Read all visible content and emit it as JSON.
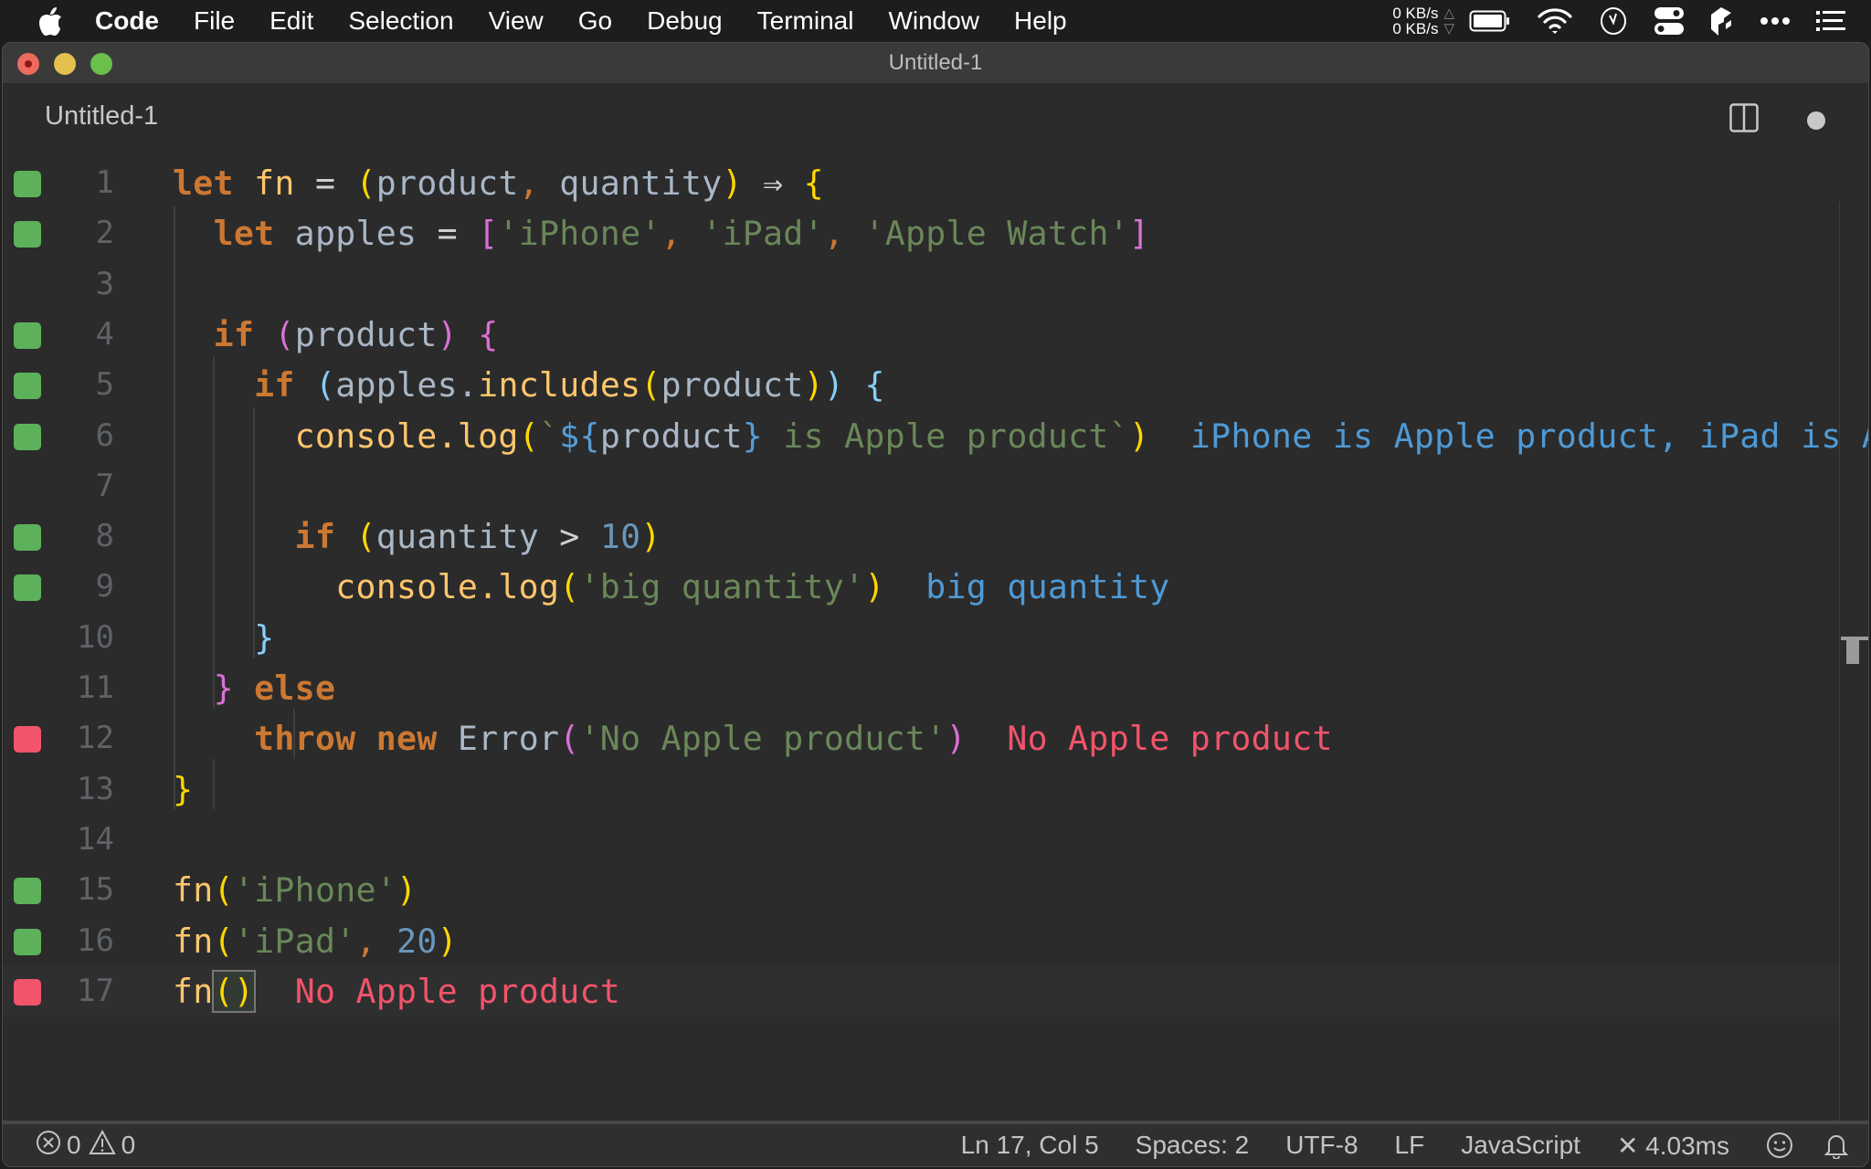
{
  "menubar": {
    "app_name": "Code",
    "items": [
      "File",
      "Edit",
      "Selection",
      "View",
      "Go",
      "Debug",
      "Terminal",
      "Window",
      "Help"
    ],
    "net_up": "0 KB/s",
    "net_down": "0 KB/s",
    "status_icons": [
      "battery-icon",
      "wifi-icon",
      "clock-icon",
      "control-center-icon",
      "app-extension-icon",
      "more-icon",
      "list-icon"
    ]
  },
  "window": {
    "title": "Untitled-1"
  },
  "tab": {
    "title": "Untitled-1",
    "dirty": true
  },
  "editor": {
    "current_line": 17,
    "lines": [
      {
        "n": "1",
        "marker": "ok",
        "tokens": [
          [
            "kw",
            "let"
          ],
          [
            "op",
            " "
          ],
          [
            "fn",
            "fn"
          ],
          [
            "op",
            " = "
          ],
          [
            "b-yellow",
            "("
          ],
          [
            "var",
            "product"
          ],
          [
            "punc",
            ", "
          ],
          [
            "var",
            "quantity"
          ],
          [
            "b-yellow",
            ")"
          ],
          [
            "op",
            " ⇒ "
          ],
          [
            "b-yellow",
            "{"
          ]
        ]
      },
      {
        "n": "2",
        "marker": "ok",
        "tokens": [
          [
            "op",
            "  "
          ],
          [
            "kw",
            "let"
          ],
          [
            "var",
            " apples "
          ],
          [
            "op",
            "= "
          ],
          [
            "b-pink",
            "["
          ],
          [
            "str",
            "'iPhone'"
          ],
          [
            "punc",
            ", "
          ],
          [
            "str",
            "'iPad'"
          ],
          [
            "punc",
            ", "
          ],
          [
            "str",
            "'Apple Watch'"
          ],
          [
            "b-pink",
            "]"
          ]
        ]
      },
      {
        "n": "3",
        "marker": "",
        "tokens": []
      },
      {
        "n": "4",
        "marker": "ok",
        "tokens": [
          [
            "op",
            "  "
          ],
          [
            "kw",
            "if"
          ],
          [
            "op",
            " "
          ],
          [
            "b-pink",
            "("
          ],
          [
            "var",
            "product"
          ],
          [
            "b-pink",
            ")"
          ],
          [
            "op",
            " "
          ],
          [
            "b-pink",
            "{"
          ]
        ]
      },
      {
        "n": "5",
        "marker": "ok",
        "tokens": [
          [
            "op",
            "    "
          ],
          [
            "kw",
            "if"
          ],
          [
            "op",
            " "
          ],
          [
            "b-blue",
            "("
          ],
          [
            "var",
            "apples."
          ],
          [
            "fn",
            "includes"
          ],
          [
            "b-yellow",
            "("
          ],
          [
            "var",
            "product"
          ],
          [
            "b-yellow",
            ")"
          ],
          [
            "b-blue",
            ")"
          ],
          [
            "op",
            " "
          ],
          [
            "b-blue",
            "{"
          ]
        ]
      },
      {
        "n": "6",
        "marker": "ok",
        "tokens": [
          [
            "op",
            "      "
          ],
          [
            "fn",
            "console.log"
          ],
          [
            "b-yellow",
            "("
          ],
          [
            "str",
            "`"
          ],
          [
            "tpl",
            "${"
          ],
          [
            "var",
            "product"
          ],
          [
            "tpl",
            "}"
          ],
          [
            "str",
            " is Apple product`"
          ],
          [
            "b-yellow",
            ")"
          ],
          [
            "op",
            "  "
          ],
          [
            "out-ok",
            "iPhone is Apple product, iPad is Apple product"
          ]
        ]
      },
      {
        "n": "7",
        "marker": "",
        "tokens": []
      },
      {
        "n": "8",
        "marker": "ok",
        "tokens": [
          [
            "op",
            "      "
          ],
          [
            "kw",
            "if"
          ],
          [
            "op",
            " "
          ],
          [
            "b-yellow",
            "("
          ],
          [
            "var",
            "quantity "
          ],
          [
            "op",
            "> "
          ],
          [
            "num",
            "10"
          ],
          [
            "b-yellow",
            ")"
          ]
        ]
      },
      {
        "n": "9",
        "marker": "ok",
        "tokens": [
          [
            "op",
            "        "
          ],
          [
            "fn",
            "console.log"
          ],
          [
            "b-yellow",
            "("
          ],
          [
            "str",
            "'big quantity'"
          ],
          [
            "b-yellow",
            ")"
          ],
          [
            "op",
            "  "
          ],
          [
            "out-ok",
            "big quantity"
          ]
        ]
      },
      {
        "n": "10",
        "marker": "",
        "tokens": [
          [
            "op",
            "    "
          ],
          [
            "b-blue",
            "}"
          ]
        ]
      },
      {
        "n": "11",
        "marker": "",
        "tokens": [
          [
            "op",
            "  "
          ],
          [
            "b-pink",
            "}"
          ],
          [
            "op",
            " "
          ],
          [
            "kw",
            "else"
          ]
        ]
      },
      {
        "n": "12",
        "marker": "err",
        "tokens": [
          [
            "op",
            "    "
          ],
          [
            "kw",
            "throw"
          ],
          [
            "op",
            " "
          ],
          [
            "kw",
            "new"
          ],
          [
            "op",
            " "
          ],
          [
            "var",
            "Error"
          ],
          [
            "b-pink",
            "("
          ],
          [
            "str",
            "'No Apple product'"
          ],
          [
            "b-pink",
            ")"
          ],
          [
            "op",
            "  "
          ],
          [
            "out-err",
            "No Apple product"
          ]
        ]
      },
      {
        "n": "13",
        "marker": "",
        "tokens": [
          [
            "b-yellow",
            "}"
          ]
        ]
      },
      {
        "n": "14",
        "marker": "",
        "tokens": []
      },
      {
        "n": "15",
        "marker": "ok",
        "tokens": [
          [
            "fn",
            "fn"
          ],
          [
            "b-yellow",
            "("
          ],
          [
            "str",
            "'iPhone'"
          ],
          [
            "b-yellow",
            ")"
          ]
        ]
      },
      {
        "n": "16",
        "marker": "ok",
        "tokens": [
          [
            "fn",
            "fn"
          ],
          [
            "b-yellow",
            "("
          ],
          [
            "str",
            "'iPad'"
          ],
          [
            "punc",
            ", "
          ],
          [
            "num",
            "20"
          ],
          [
            "b-yellow",
            ")"
          ]
        ]
      },
      {
        "n": "17",
        "marker": "err",
        "tokens": [
          [
            "fn",
            "fn"
          ],
          [
            "b-yellow box",
            "()"
          ],
          [
            "op",
            "  "
          ],
          [
            "out-err",
            "No Apple product"
          ]
        ]
      }
    ]
  },
  "statusbar": {
    "errors": "0",
    "warnings": "0",
    "position": "Ln 17, Col 5",
    "spaces": "Spaces: 2",
    "encoding": "UTF-8",
    "eol": "LF",
    "language": "JavaScript",
    "timing": "✕ 4.03ms"
  },
  "colors": {
    "success_marker": "#5cb15a",
    "error_marker": "#f1546b",
    "output_ok": "#4e9ad6",
    "output_error": "#f1546b"
  }
}
